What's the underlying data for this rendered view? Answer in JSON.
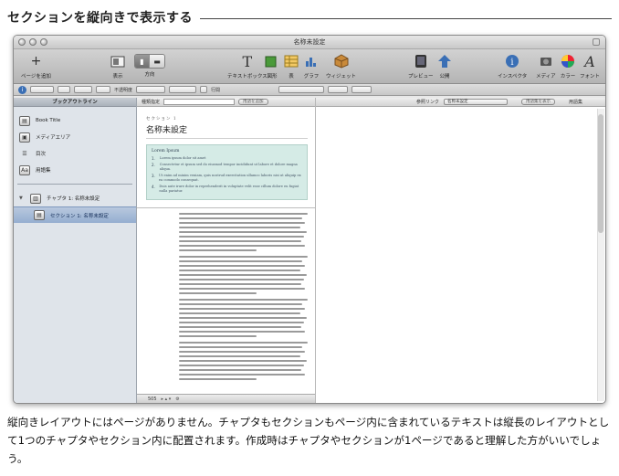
{
  "page": {
    "heading": "セクションを縦向きで表示する",
    "caption": "縦向きレイアウトにはページがありません。チャプタもセクションもページ内に含まれているテキストは縦長のレイアウトとして1つのチャプタやセクション内に配置されます。作成時はチャプタやセクションが1ページであると理解した方がいいでしょう。"
  },
  "window": {
    "title": "名称未設定"
  },
  "toolbar": {
    "add_page": "ページを追加",
    "view": "表示",
    "orientation": "方向",
    "textbox": "テキストボックス",
    "shape": "図形",
    "table": "表",
    "chart": "グラフ",
    "widget": "ウィジェット",
    "preview": "プレビュー",
    "publish": "公開",
    "inspector": "インスペクタ",
    "media": "メディア",
    "colors": "カラー",
    "fonts": "フォント"
  },
  "format_bar": {
    "opacity_label": "不透明度",
    "lines_label": "行間"
  },
  "sidebar": {
    "header": "ブックアウトライン",
    "items": [
      {
        "label": "Book Title"
      },
      {
        "label": "メディアエリア"
      },
      {
        "label": "目次"
      },
      {
        "label": "用語集"
      }
    ],
    "chapter": "チャプタ 1: 名称未設定",
    "section": "セクション 1: 名称未設定"
  },
  "editor": {
    "topbar_label": "種類指定",
    "topbar_button": "用語を追加",
    "kicker": "セクション 1",
    "section_title": "名称未設定",
    "summary_title": "Lorem Ipsum",
    "summary_items": [
      "Lorem ipsum dolor sit amet",
      "Consectetur et ipsum sed do eiusmod tempor incididunt ut labore et dolore magna aliqua.",
      "Ut enim ad minim veniam, quis nostrud exercitation ullamco laboris nisi ut aliquip ex ea commodo consequat.",
      "Duis aute irure dolor in reprehenderit in voluptate velit esse cillum dolore eu fugiat nulla pariatur."
    ],
    "status_count": "505"
  },
  "rightpane": {
    "label": "参照リンク",
    "select_value": "名称未設定",
    "button": "用語集を表示",
    "right_label": "用語集"
  }
}
